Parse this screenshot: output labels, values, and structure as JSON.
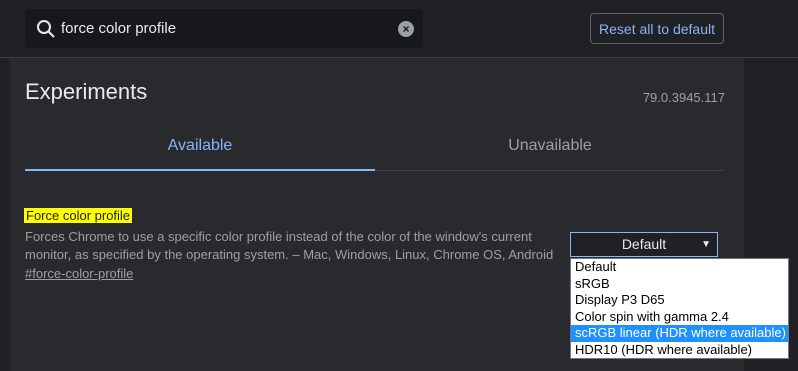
{
  "search": {
    "value": "force color profile"
  },
  "header": {
    "reset_label": "Reset all to default"
  },
  "page": {
    "title": "Experiments",
    "version": "79.0.3945.117"
  },
  "tabs": [
    {
      "label": "Available"
    },
    {
      "label": "Unavailable"
    }
  ],
  "experiment": {
    "title": "Force color profile",
    "description": "Forces Chrome to use a specific color profile instead of the color of the window's current monitor, as specified by the operating system. – Mac, Windows, Linux, Chrome OS, Android",
    "link": "#force-color-profile",
    "selected": "Default",
    "options": [
      "Default",
      "sRGB",
      "Display P3 D65",
      "Color spin with gamma 2.4",
      "scRGB linear (HDR where available)",
      "HDR10 (HDR where available)"
    ],
    "highlighted_option": "scRGB linear (HDR where available)"
  },
  "colors": {
    "accent": "#8ab4f8",
    "highlight": "#ffff00",
    "option_selected_bg": "#1e90ff"
  }
}
